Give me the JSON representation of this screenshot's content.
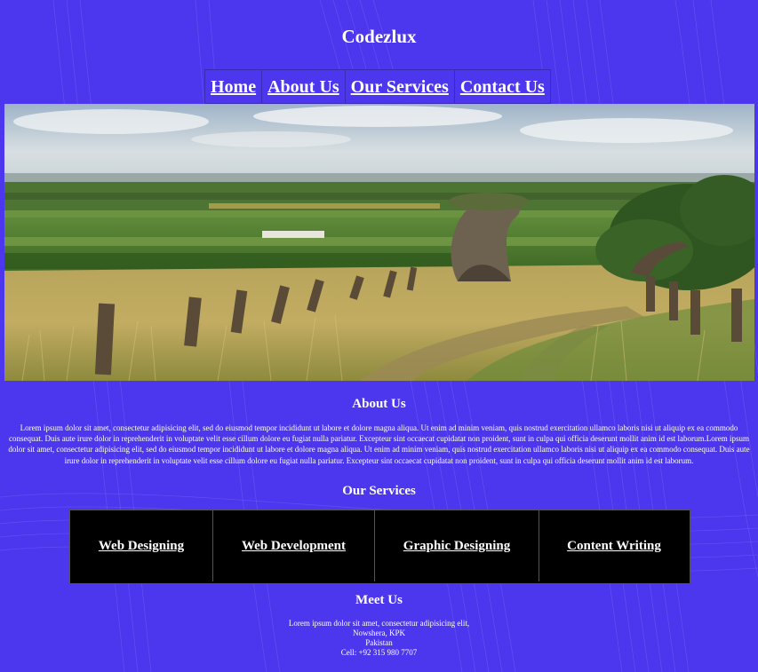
{
  "site": {
    "title": "Codezlux"
  },
  "nav": {
    "items": [
      "Home",
      "About Us",
      "Our Services",
      "Contact Us"
    ]
  },
  "about": {
    "heading": "About Us",
    "text": "Lorem ipsum dolor sit amet, consectetur adipisicing elit, sed do eiusmod tempor incididunt ut labore et dolore magna aliqua. Ut enim ad minim veniam, quis nostrud exercitation ullamco laboris nisi ut aliquip ex ea commodo consequat. Duis aute irure dolor in reprehenderit in voluptate velit esse cillum dolore eu fugiat nulla pariatur. Excepteur sint occaecat cupidatat non proident, sunt in culpa qui officia deserunt mollit anim id est laborum.Lorem ipsum dolor sit amet, consectetur adipisicing elit, sed do eiusmod tempor incididunt ut labore et dolore magna aliqua. Ut enim ad minim veniam, quis nostrud exercitation ullamco laboris nisi ut aliquip ex ea commodo consequat. Duis aute irure dolor in reprehenderit in voluptate velit esse cillum dolore eu fugiat nulla pariatur. Excepteur sint occaecat cupidatat non proident, sunt in culpa qui officia deserunt mollit anim id est laborum."
  },
  "services": {
    "heading": "Our Services",
    "items": [
      "Web Designing",
      "Web Development",
      "Graphic Designing",
      "Content Writing"
    ]
  },
  "meet": {
    "heading": "Meet Us",
    "line1": "Lorem ipsum dolor sit amet, consectetur adipisicing elit,",
    "line2": "Nowshera, KPK",
    "line3": "Pakistan",
    "line4": "Cell: +92 315 980 7707"
  },
  "colors": {
    "background": "#4c36ee",
    "services_bg": "#000000",
    "text": "#ffffff"
  }
}
